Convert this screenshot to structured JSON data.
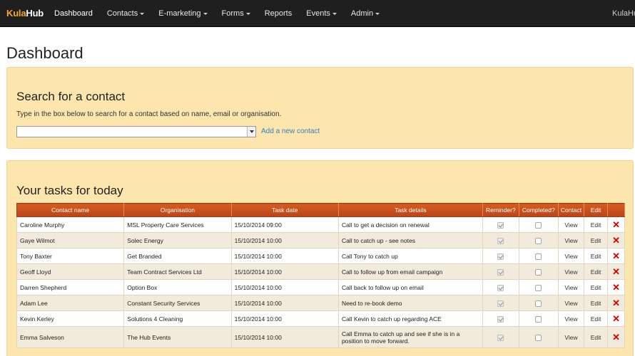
{
  "brand": {
    "part1": "Kula",
    "part2": "Hub"
  },
  "nav": {
    "items": [
      {
        "label": "Dashboard",
        "dropdown": false
      },
      {
        "label": "Contacts",
        "dropdown": true
      },
      {
        "label": "E-marketing",
        "dropdown": true
      },
      {
        "label": "Forms",
        "dropdown": true
      },
      {
        "label": "Reports",
        "dropdown": false
      },
      {
        "label": "Events",
        "dropdown": true
      },
      {
        "label": "Admin",
        "dropdown": true
      }
    ],
    "user": "KulaHub"
  },
  "page": {
    "title": "Dashboard"
  },
  "search": {
    "heading": "Search for a contact",
    "help": "Type in the box below to search for a contact based on name, email or organisation.",
    "value": "",
    "placeholder": "",
    "add_link": "Add a new contact"
  },
  "tasks": {
    "heading": "Your tasks for today",
    "columns": [
      "Contact name",
      "Organisation",
      "Task date",
      "Task details",
      "Reminder?",
      "Completed?",
      "Contact",
      "Edit"
    ],
    "view_label": "View",
    "edit_label": "Edit",
    "delete_glyph": "✕",
    "rows": [
      {
        "name": "Caroline Murphy",
        "org": "MSL Property Care Services",
        "date": "15/10/2014 09:00",
        "details": "Call to get a decision on renewal",
        "reminder": true,
        "completed": false
      },
      {
        "name": "Gaye Wilmot",
        "org": "Solec Energy",
        "date": "15/10/2014 10:00",
        "details": "Call to catch up - see notes",
        "reminder": true,
        "completed": false
      },
      {
        "name": "Tony Baxter",
        "org": "Get Branded",
        "date": "15/10/2014 10:00",
        "details": "Call Tony to catch up",
        "reminder": true,
        "completed": false
      },
      {
        "name": "Geoff Lloyd",
        "org": "Team Contract Services Ltd",
        "date": "15/10/2014 10:00",
        "details": "Call to follow up from email campaign",
        "reminder": true,
        "completed": false
      },
      {
        "name": "Darren Shepherd",
        "org": "Option Box",
        "date": "15/10/2014 10:00",
        "details": "Call back to follow up on email",
        "reminder": true,
        "completed": false
      },
      {
        "name": "Adam Lee",
        "org": "Constant Security Services",
        "date": "15/10/2014 10:00",
        "details": "Need to re-book demo",
        "reminder": true,
        "completed": false
      },
      {
        "name": "Kevin Kerley",
        "org": "Solutions 4 Cleaning",
        "date": "15/10/2014 10:00",
        "details": "Call Kevin to catch up regarding ACE",
        "reminder": true,
        "completed": false
      },
      {
        "name": "Emma Salveson",
        "org": "The Hub Events",
        "date": "15/10/2014 10:00",
        "details": "Call Emma to catch up and see if she is in a position to move forward.",
        "reminder": true,
        "completed": false
      }
    ]
  },
  "colors": {
    "nav_bg": "#1f1f1f",
    "brand_accent": "#f0a830",
    "panel_bg": "#fde6ad",
    "table_header": "#c8501a",
    "delete": "#d40000",
    "link": "#3a7bc0"
  }
}
